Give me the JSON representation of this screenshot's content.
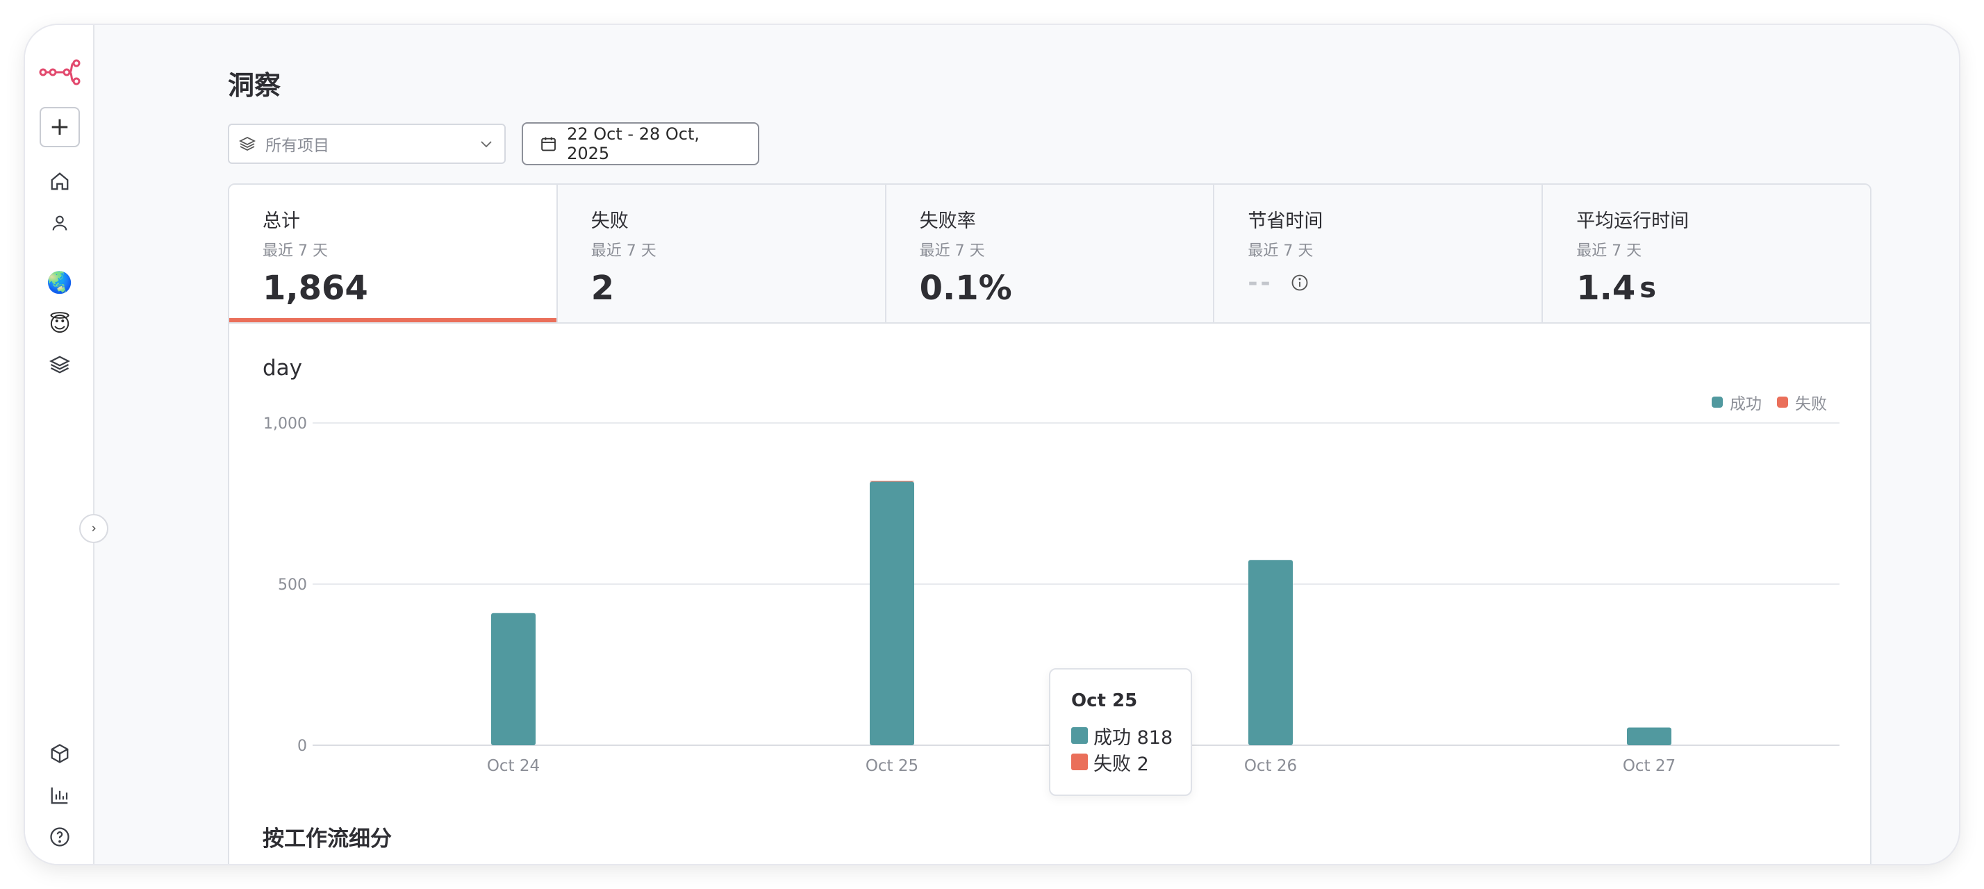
{
  "page": {
    "title": "洞察"
  },
  "filters": {
    "project_placeholder": "所有项目",
    "date_range": "22 Oct - 28 Oct, 2025"
  },
  "stats": [
    {
      "label": "总计",
      "sub": "最近 7 天",
      "value": "1,864"
    },
    {
      "label": "失败",
      "sub": "最近 7 天",
      "value": "2"
    },
    {
      "label": "失败率",
      "sub": "最近 7 天",
      "value": "0.1%"
    },
    {
      "label": "节省时间",
      "sub": "最近 7 天",
      "value": "--"
    },
    {
      "label": "平均运行时间",
      "sub": "最近 7 天",
      "value": "1.4",
      "unit": "s"
    }
  ],
  "chart": {
    "title": "day",
    "legend": {
      "success": "成功",
      "failure": "失败"
    },
    "tooltip": {
      "date": "Oct 25",
      "success": "成功 818",
      "failure": "失败 2"
    }
  },
  "breakdown": {
    "title": "按工作流细分"
  },
  "colors": {
    "success": "#51999f",
    "failure": "#ea6f5a",
    "accent": "#ea6f5a"
  },
  "chart_data": {
    "type": "bar",
    "categories": [
      "Oct 24",
      "Oct 25",
      "Oct 26",
      "Oct 27"
    ],
    "series": [
      {
        "name": "成功",
        "values": [
          410,
          818,
          575,
          55
        ]
      },
      {
        "name": "失败",
        "values": [
          0,
          2,
          0,
          0
        ]
      }
    ],
    "yticks": [
      "0",
      "500",
      "1,000"
    ],
    "ylim": [
      0,
      1000
    ],
    "grid": true,
    "legend_position": "top-right",
    "xlabel": "",
    "ylabel": ""
  }
}
